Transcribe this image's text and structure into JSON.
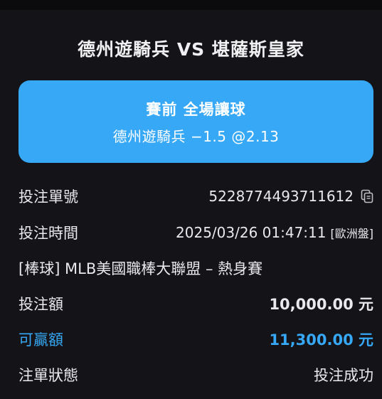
{
  "header": {
    "match": "德州遊騎兵  VS  堪薩斯皇家"
  },
  "bet_card": {
    "line1": "賽前  全場讓球",
    "line2": "德州遊騎兵 −1.5 @2.13"
  },
  "details": {
    "order_label": "投注單號",
    "order_value": "5228774493711612",
    "time_label": "投注時間",
    "time_value": "2025/03/26 01:47:11",
    "time_tag": "[歐洲盤]",
    "league_text": "[棒球] MLB美國職棒大聯盟 – 熱身賽",
    "stake_label": "投注額",
    "stake_value": "10,000.00 元",
    "win_label": "可贏額",
    "win_value": "11,300.00 元",
    "status_label": "注單狀態",
    "status_value": "投注成功"
  },
  "colors": {
    "accent": "#36a8f5",
    "background": "#141418"
  }
}
